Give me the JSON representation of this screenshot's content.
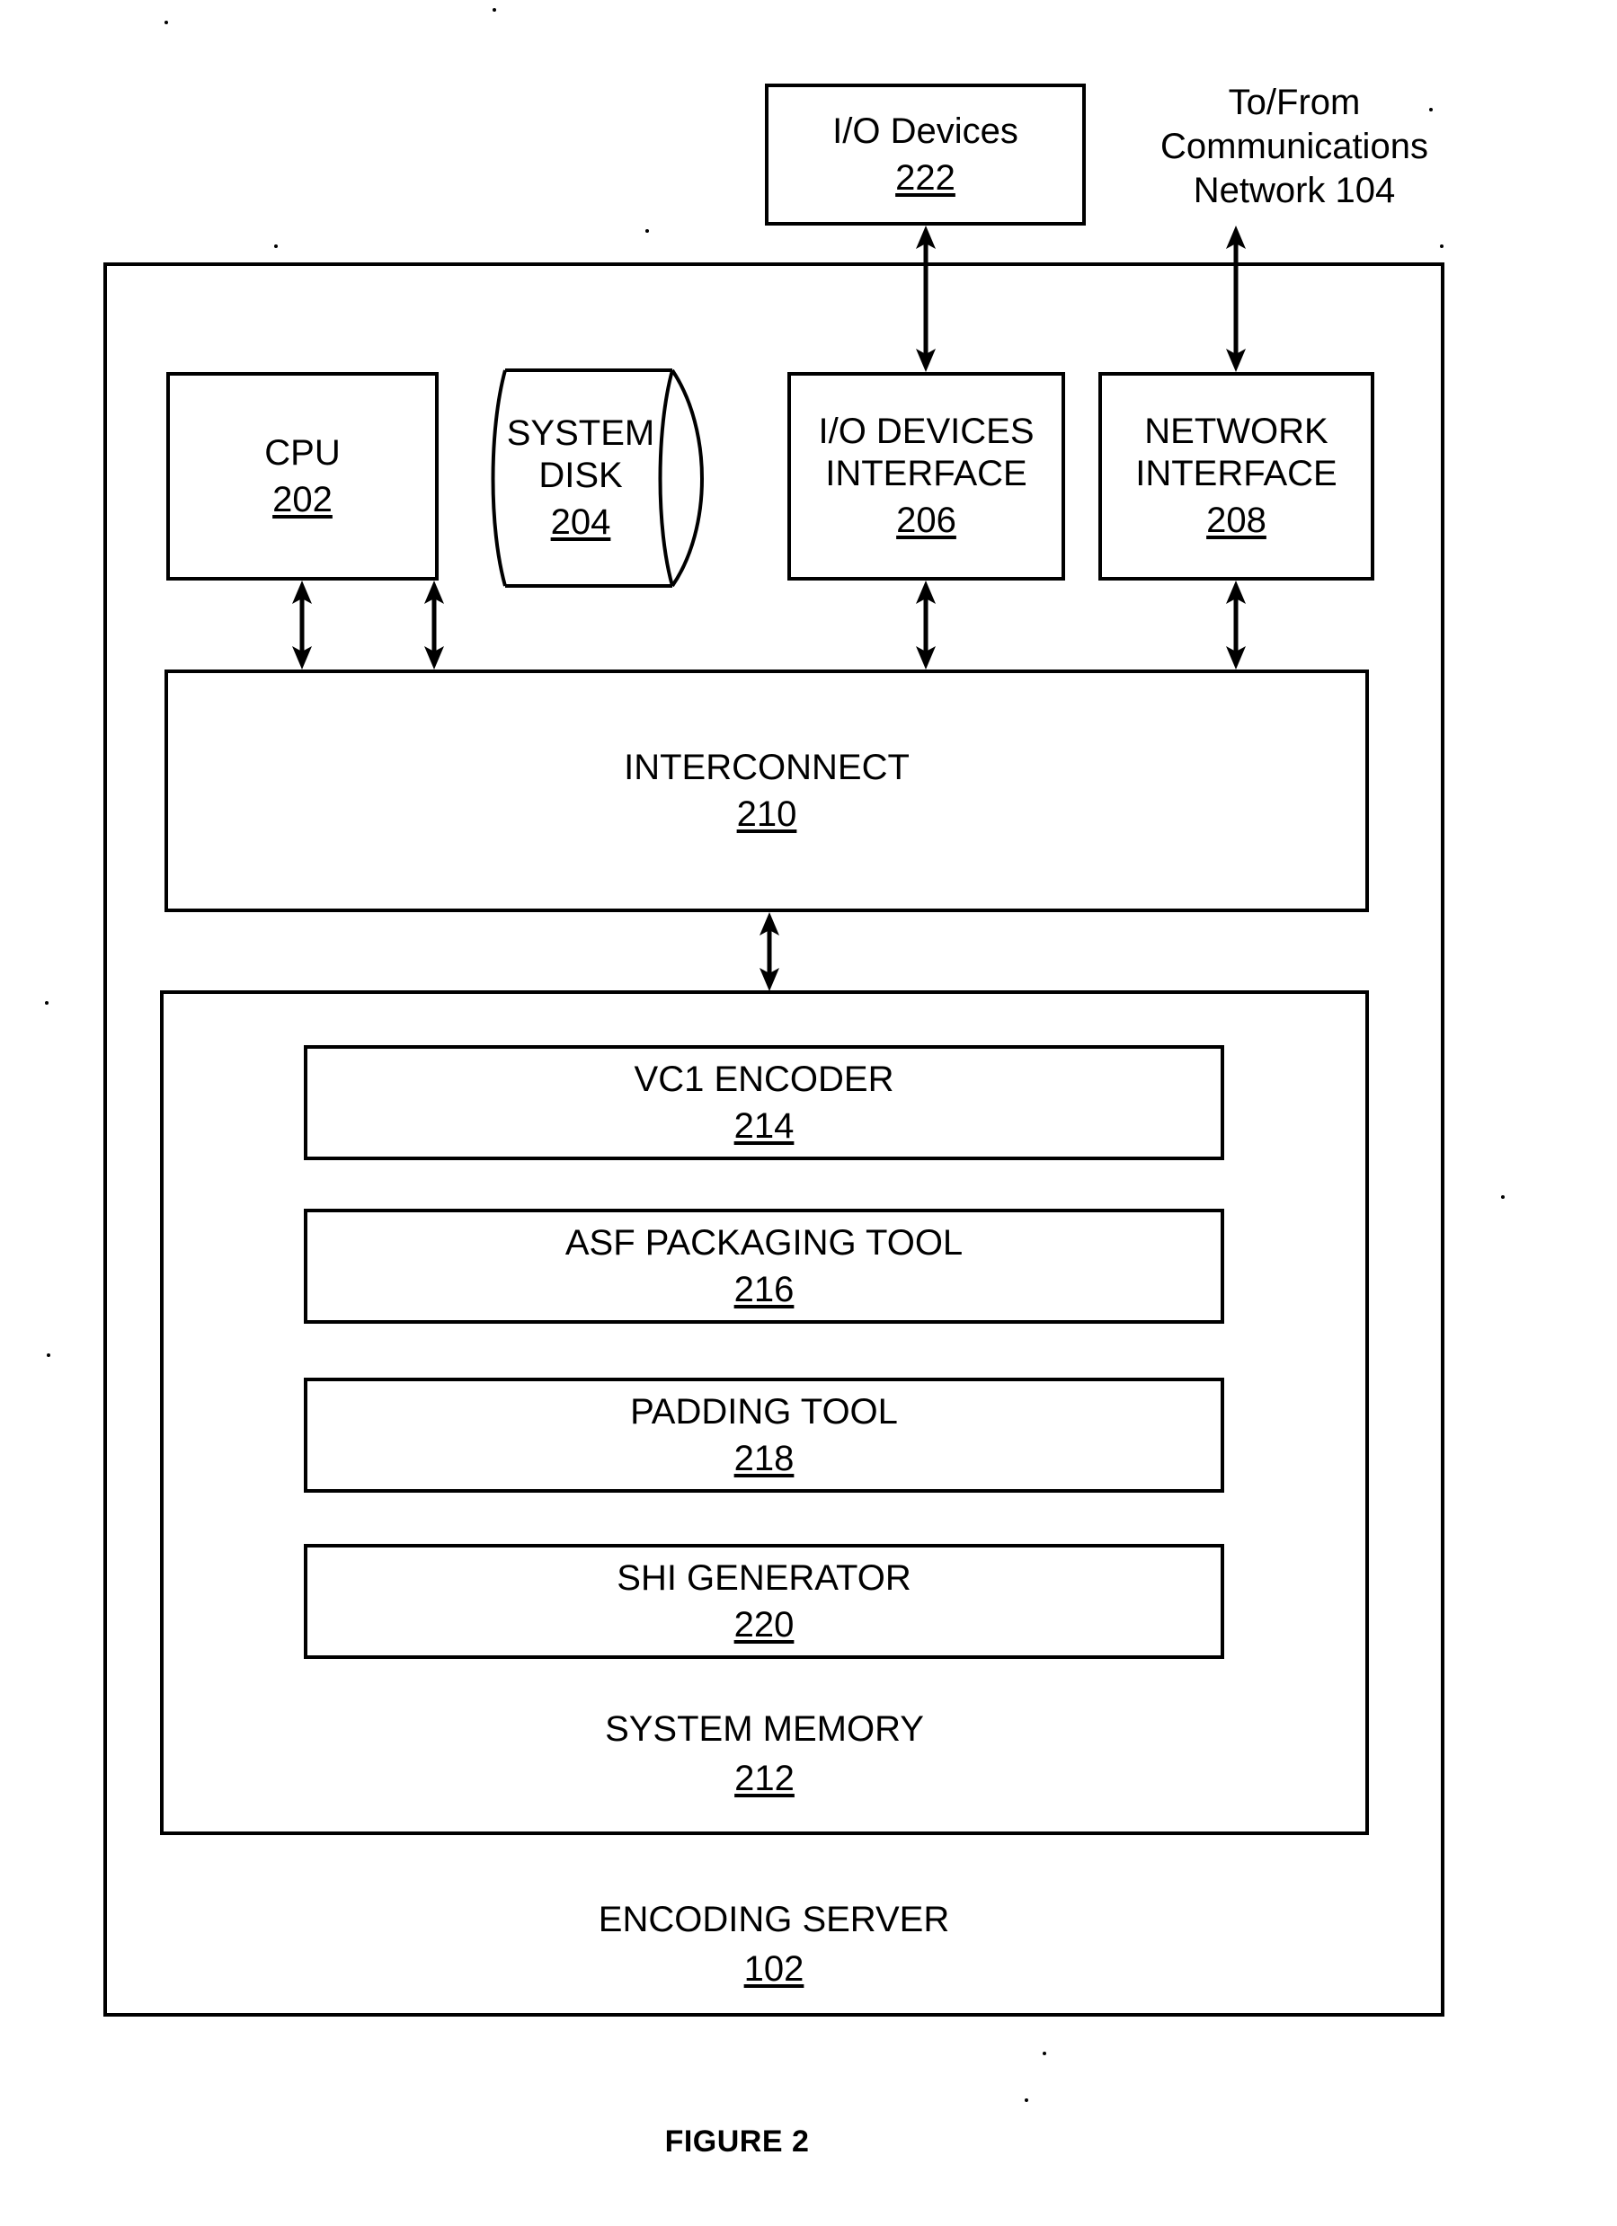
{
  "figure": {
    "caption": "FIGURE 2"
  },
  "external": {
    "io_devices": {
      "label": "I/O Devices",
      "ref": "222"
    },
    "network_note": {
      "line1": "To/From",
      "line2": "Communications",
      "line3": "Network 104"
    }
  },
  "server": {
    "label": "ENCODING SERVER",
    "ref": "102",
    "components": [
      {
        "name": "cpu",
        "label": "CPU",
        "ref": "202"
      },
      {
        "name": "system-disk",
        "label_line1": "SYSTEM",
        "label_line2": "DISK",
        "ref": "204"
      },
      {
        "name": "io-devices-interface",
        "label_line1": "I/O DEVICES",
        "label_line2": "INTERFACE",
        "ref": "206"
      },
      {
        "name": "network-interface",
        "label_line1": "NETWORK",
        "label_line2": "INTERFACE",
        "ref": "208"
      }
    ],
    "interconnect": {
      "label": "INTERCONNECT",
      "ref": "210"
    },
    "system_memory": {
      "label": "SYSTEM MEMORY",
      "ref": "212",
      "modules": [
        {
          "name": "vc1-encoder",
          "label": "VC1 ENCODER",
          "ref": "214"
        },
        {
          "name": "asf-packaging-tool",
          "label": "ASF PACKAGING TOOL",
          "ref": "216"
        },
        {
          "name": "padding-tool",
          "label": "PADDING TOOL",
          "ref": "218"
        },
        {
          "name": "shi-generator",
          "label": "SHI GENERATOR",
          "ref": "220"
        }
      ]
    }
  },
  "colors": {
    "ink": "#000000",
    "paper": "#ffffff"
  }
}
